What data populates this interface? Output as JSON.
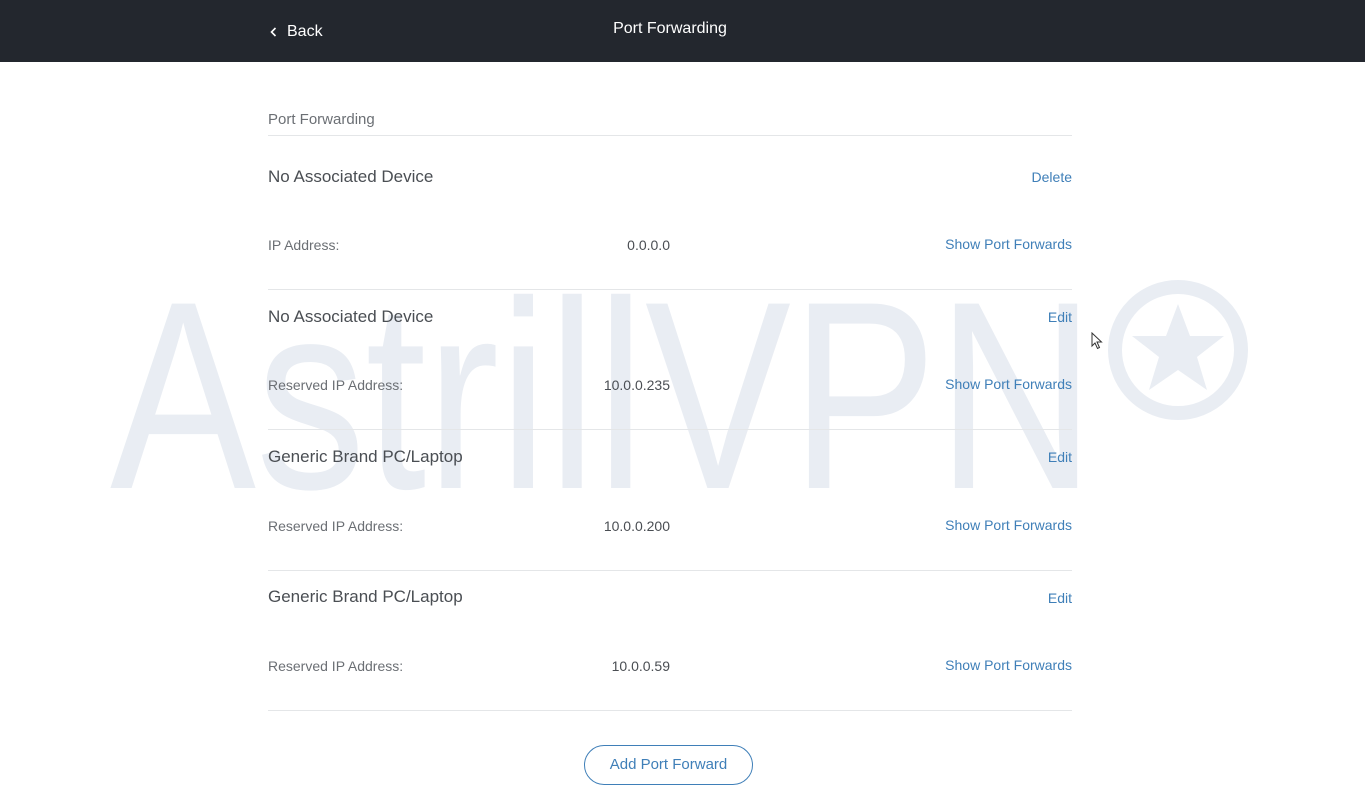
{
  "header": {
    "back_label": "Back",
    "title": "Port Forwarding"
  },
  "watermark": {
    "text": "AstrillVPN",
    "icon": "star-circle-icon"
  },
  "section": {
    "title": "Port Forwarding"
  },
  "entries": [
    {
      "device_name": "No Associated Device",
      "action_label": "Delete",
      "ip_label": "IP Address:",
      "ip_value": "0.0.0.0",
      "show_label": "Show Port Forwards"
    },
    {
      "device_name": "No Associated Device",
      "action_label": "Edit",
      "ip_label": "Reserved IP Address:",
      "ip_value": "10.0.0.235",
      "show_label": "Show Port Forwards"
    },
    {
      "device_name": "Generic Brand PC/Laptop",
      "action_label": "Edit",
      "ip_label": "Reserved IP Address:",
      "ip_value": "10.0.0.200",
      "show_label": "Show Port Forwards"
    },
    {
      "device_name": "Generic Brand PC/Laptop",
      "action_label": "Edit",
      "ip_label": "Reserved IP Address:",
      "ip_value": "10.0.0.59",
      "show_label": "Show Port Forwards"
    }
  ],
  "footer": {
    "add_label": "Add Port Forward"
  },
  "colors": {
    "header_bg": "#23272e",
    "link": "#3f7fb8",
    "watermark": "#e9edf3"
  }
}
